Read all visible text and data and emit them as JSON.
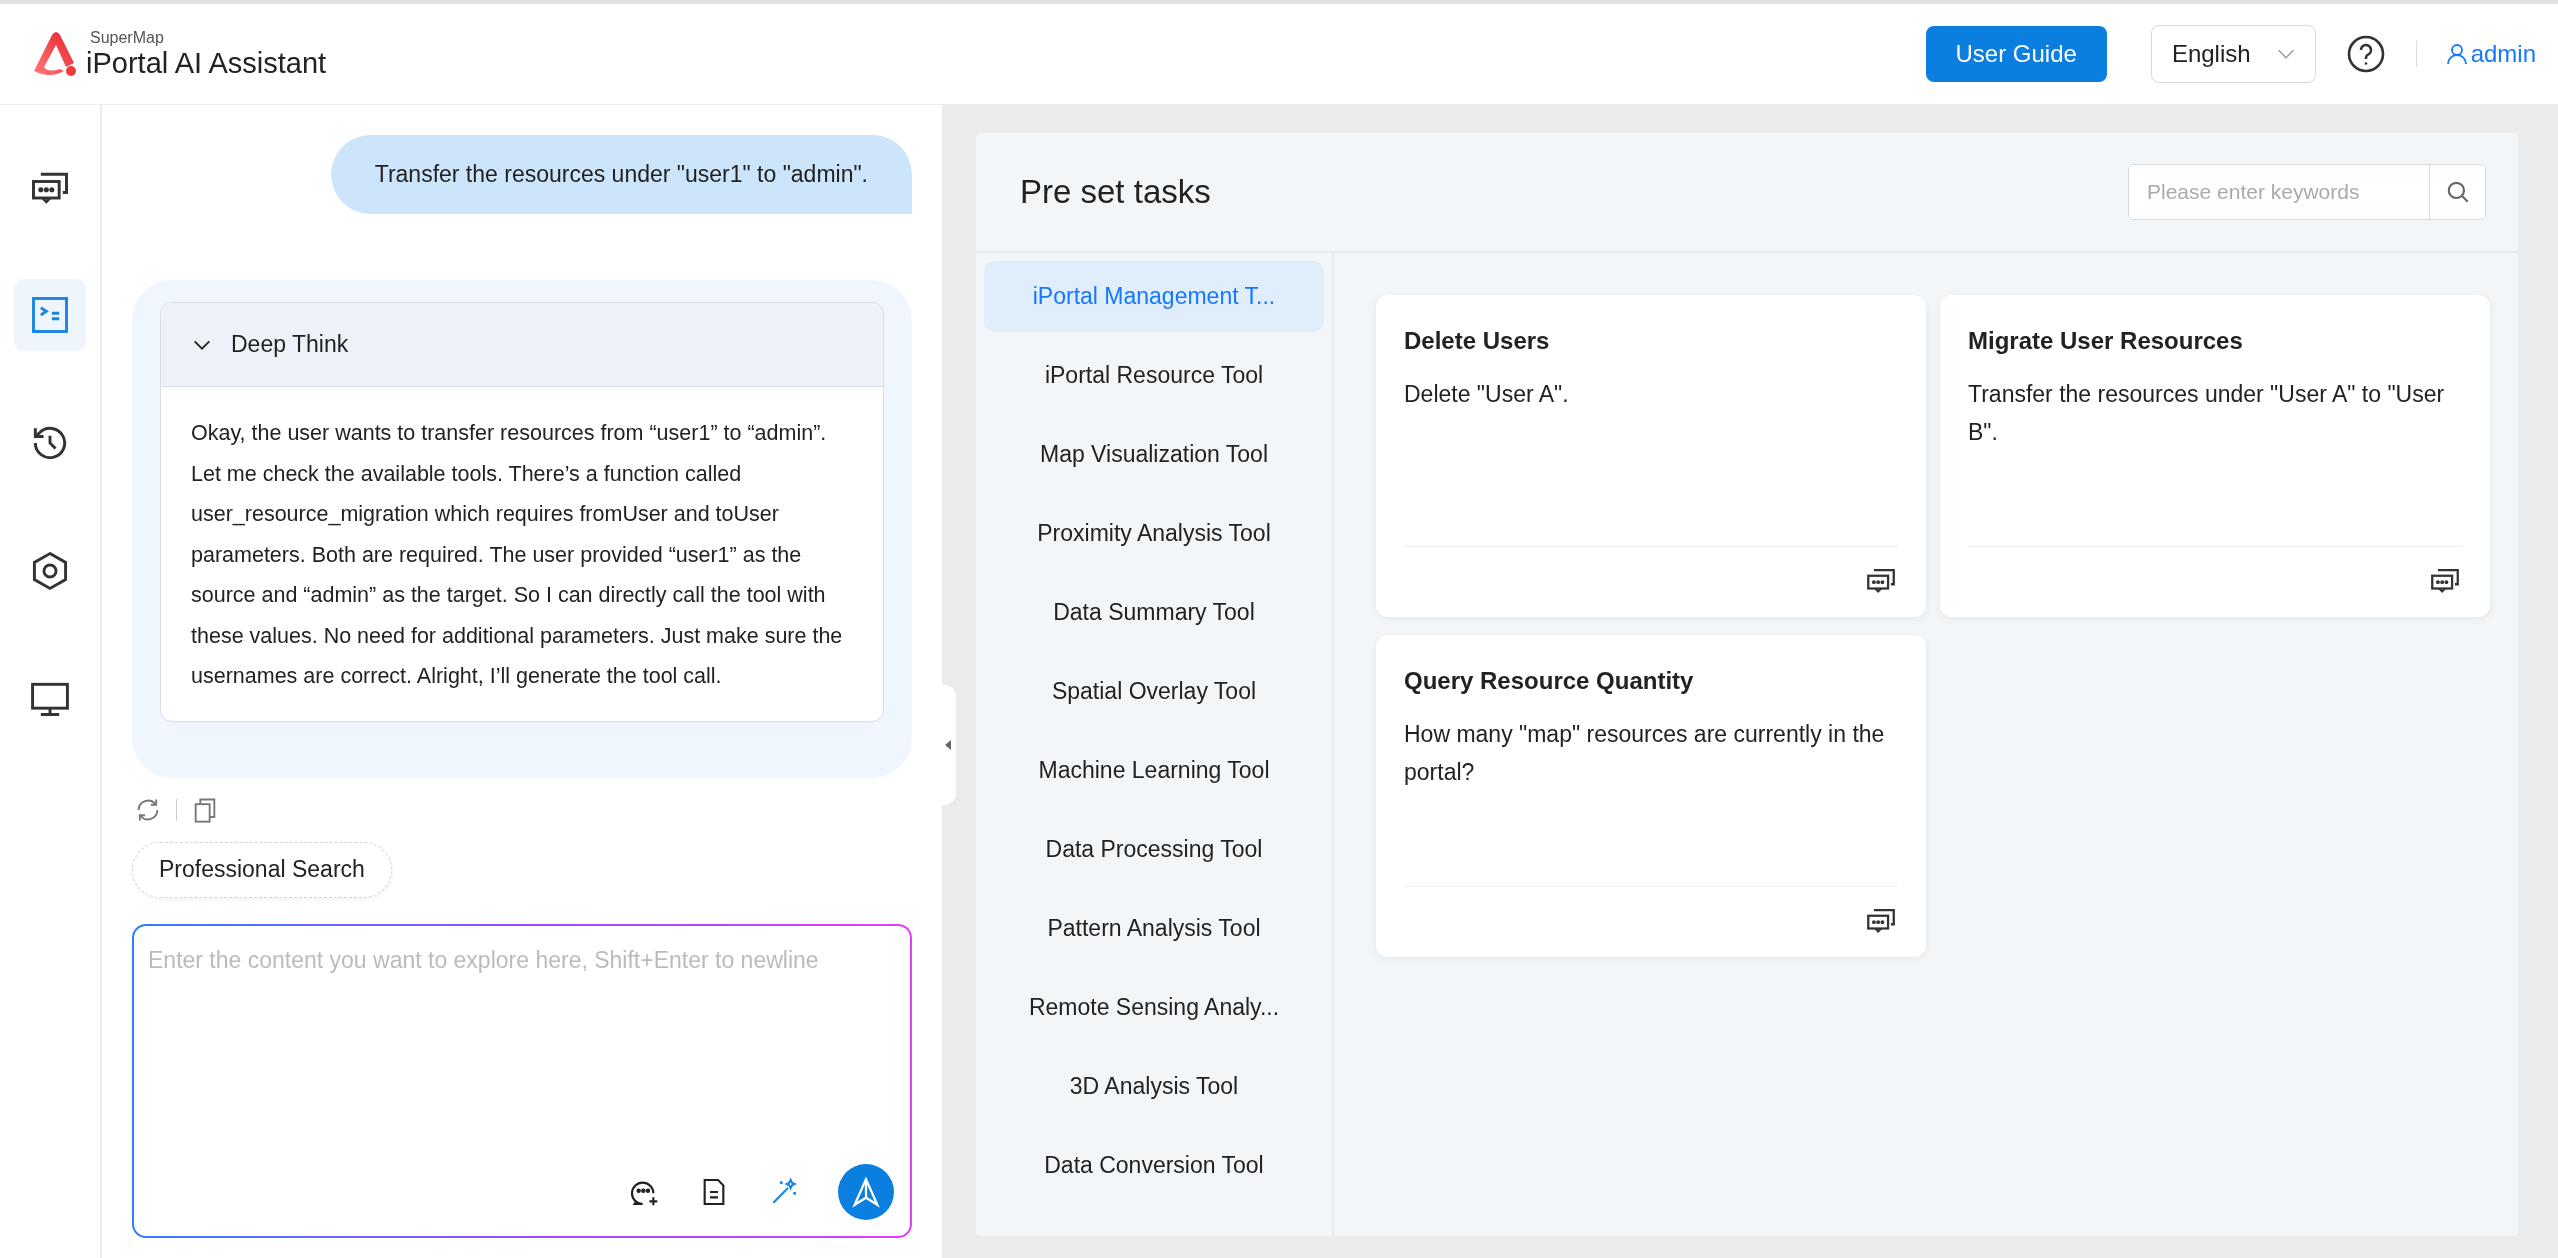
{
  "header": {
    "brand_small": "SuperMap",
    "brand_title": "iPortal AI Assistant",
    "guide_button": "User Guide",
    "language": "English",
    "user": "admin"
  },
  "rail": [
    {
      "kind": "chat",
      "selected": false
    },
    {
      "kind": "terminal",
      "selected": true
    },
    {
      "kind": "history",
      "selected": false
    },
    {
      "kind": "hexagon",
      "selected": false
    },
    {
      "kind": "monitor",
      "selected": false
    }
  ],
  "chat": {
    "user_message": "Transfer the resources under \"user1\" to \"admin\".",
    "deep_think": {
      "title": "Deep Think",
      "expanded": true,
      "text": "Okay, the user wants to transfer resources from “user1” to “admin”. Let me check the available tools. There’s a function called user_resource_migration which requires fromUser and toUser parameters. Both are required. The user provided “user1” as the source and “admin” as the target. So I can directly call the tool with these values. No need for additional parameters. Just make sure the usernames are correct. Alright, I’ll generate the tool call."
    },
    "chip": "Professional Search",
    "input": {
      "placeholder": "Enter the content you want to explore here, Shift+Enter to newline"
    }
  },
  "tasks": {
    "title": "Pre set tasks",
    "search": {
      "placeholder": "Please enter keywords"
    },
    "categories": [
      {
        "label": "iPortal Management T...",
        "selected": true
      },
      {
        "label": "iPortal Resource Tool",
        "selected": false
      },
      {
        "label": "Map Visualization Tool",
        "selected": false
      },
      {
        "label": "Proximity Analysis Tool",
        "selected": false
      },
      {
        "label": "Data Summary Tool",
        "selected": false
      },
      {
        "label": "Spatial Overlay Tool",
        "selected": false
      },
      {
        "label": "Machine Learning Tool",
        "selected": false
      },
      {
        "label": "Data Processing Tool",
        "selected": false
      },
      {
        "label": "Pattern Analysis Tool",
        "selected": false
      },
      {
        "label": "Remote Sensing Analy...",
        "selected": false
      },
      {
        "label": "3D Analysis Tool",
        "selected": false
      },
      {
        "label": "Data Conversion Tool",
        "selected": false
      }
    ],
    "cards": [
      {
        "title": "Delete Users",
        "text": "Delete \"User A\"."
      },
      {
        "title": "Migrate User Resources",
        "text": "Transfer the resources under \"User A\" to \"User B\"."
      },
      {
        "title": "Query Resource Quantity",
        "text": "How many \"map\" resources are currently in the portal?"
      }
    ]
  }
}
